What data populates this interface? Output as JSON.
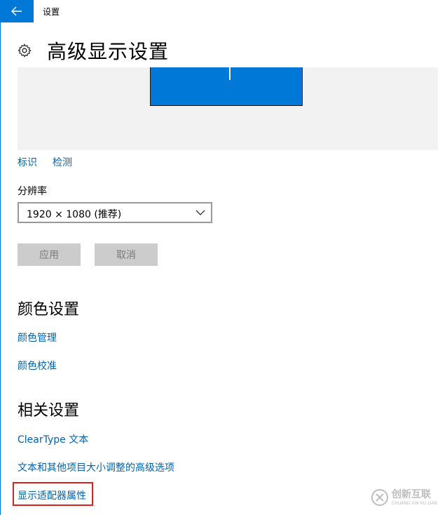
{
  "window": {
    "title": "设置"
  },
  "header": {
    "page_title": "高级显示设置"
  },
  "display": {
    "identify_label": "标识",
    "detect_label": "检测"
  },
  "resolution": {
    "label": "分辨率",
    "value": "1920 × 1080 (推荐)"
  },
  "actions": {
    "apply_label": "应用",
    "cancel_label": "取消"
  },
  "color_settings": {
    "title": "颜色设置",
    "links": [
      "颜色管理",
      "颜色校准"
    ]
  },
  "related_settings": {
    "title": "相关设置",
    "links": [
      "ClearType 文本",
      "文本和其他项目大小调整的高级选项",
      "显示适配器属性"
    ]
  },
  "watermark": {
    "brand": "创新互联",
    "sub": "CHUANG XIN HU LIAN"
  },
  "colors": {
    "accent": "#0078d7",
    "link": "#0063b1",
    "highlight": "#e0201b"
  }
}
